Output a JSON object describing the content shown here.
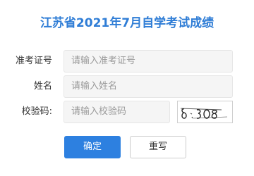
{
  "page": {
    "title": "江苏省2021年7月自学考试成绩"
  },
  "form": {
    "admission": {
      "label": "准考证号",
      "placeholder": "请输入准考证号",
      "value": ""
    },
    "name": {
      "label": "姓名",
      "placeholder": "请输入姓名",
      "value": ""
    },
    "captcha": {
      "label": "校验码:",
      "placeholder": "请输入校验码",
      "value": "",
      "image_text": "8308"
    }
  },
  "buttons": {
    "submit": "确定",
    "reset": "重写"
  },
  "colors": {
    "title": "#2f7dd6",
    "primary_button": "#2d80e0",
    "input_background": "#f5f5f5"
  }
}
